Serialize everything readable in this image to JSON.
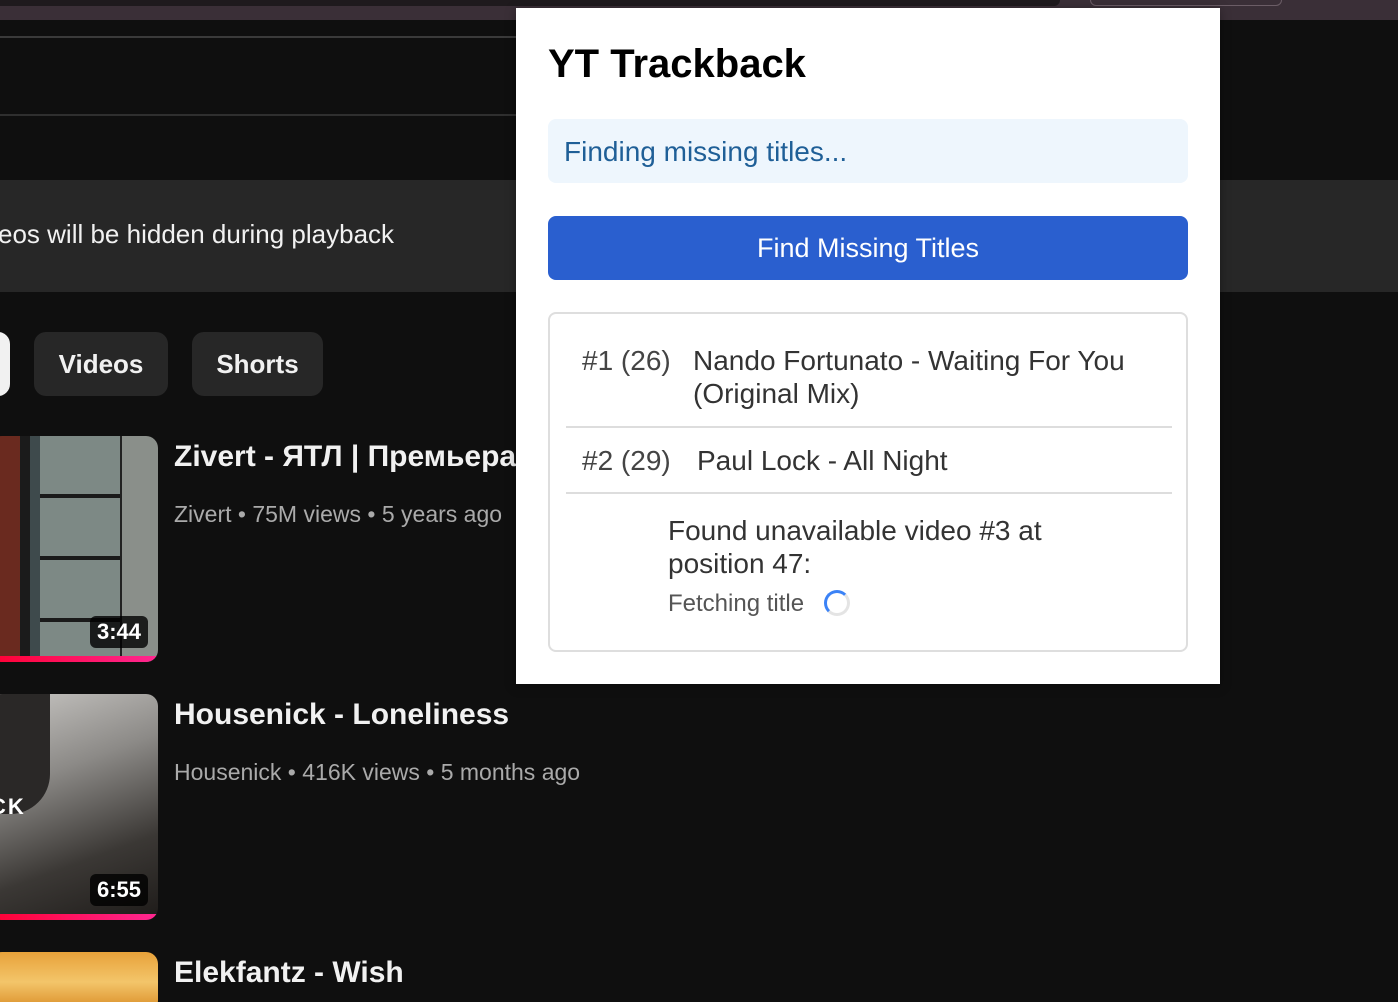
{
  "youtube": {
    "notice": "eos will be hidden during playback",
    "chips": [
      {
        "label": "Videos"
      },
      {
        "label": "Shorts"
      }
    ],
    "videos": [
      {
        "title": "Zivert - ЯТЛ | Премьера",
        "channel": "Zivert",
        "views": "75M views",
        "age": "5 years ago",
        "duration": "3:44"
      },
      {
        "title": "Housenick - Loneliness",
        "channel": "Housenick",
        "views": "416K views",
        "age": "5 months ago",
        "duration": "6:55"
      },
      {
        "title": "Elekfantz - Wish"
      }
    ],
    "thumb2_text": "CK",
    "separator": "•"
  },
  "popup": {
    "title": "YT Trackback",
    "status": "Finding missing titles...",
    "button_label": "Find Missing Titles",
    "results": [
      {
        "index": "#1 (26)",
        "title": "Nando Fortunato - Waiting For You (Original Mix)"
      },
      {
        "index": "#2 (29)",
        "title": "Paul Lock - All Night"
      }
    ],
    "pending": {
      "message": "Found unavailable video #3 at position 47:",
      "fetching": "Fetching title"
    },
    "colors": {
      "button": "#2a5fcf",
      "status_bg": "#eef6fd",
      "status_text": "#1f5f97",
      "spinner": "#3b82f6"
    }
  }
}
